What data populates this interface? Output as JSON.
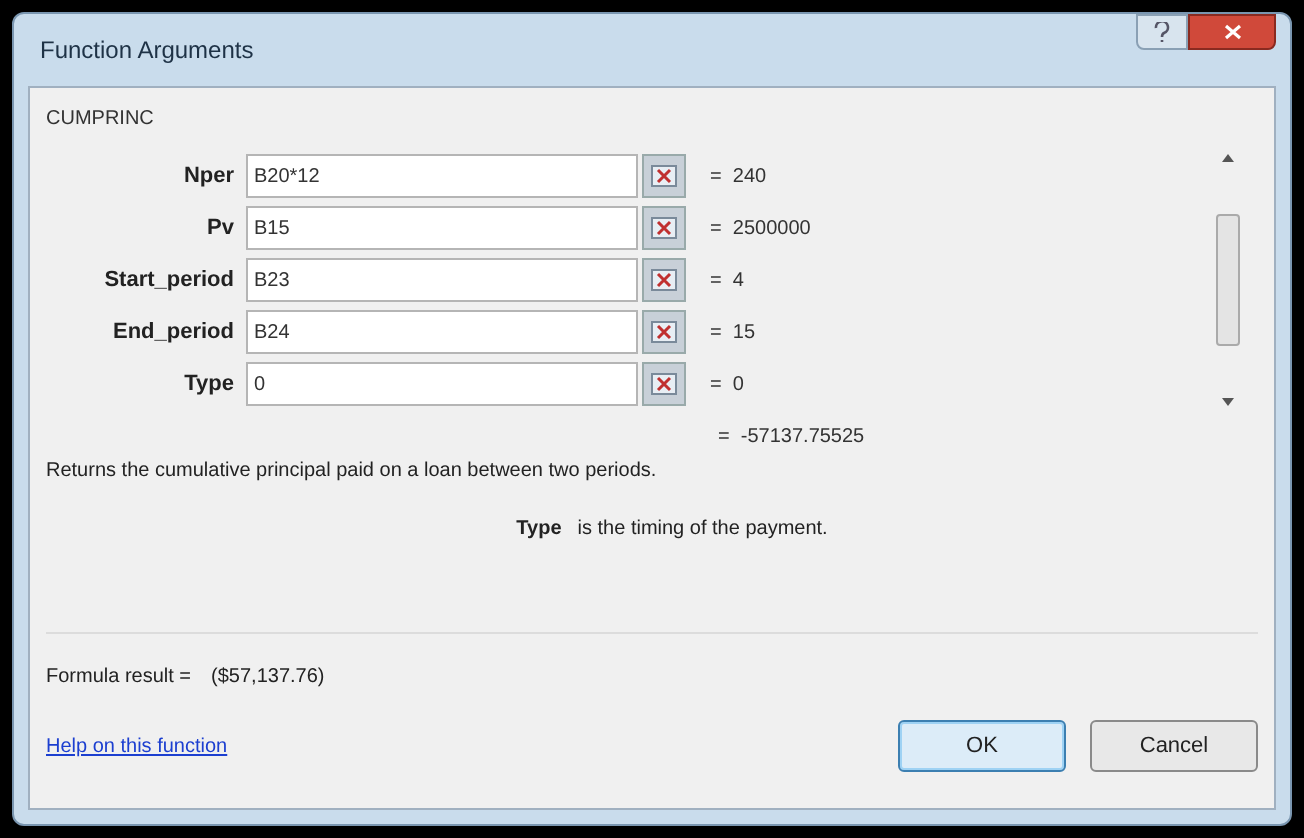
{
  "window": {
    "title": "Function Arguments"
  },
  "function_name": "CUMPRINC",
  "arguments": [
    {
      "label": "Nper",
      "value": "B20*12",
      "result": "=  240"
    },
    {
      "label": "Pv",
      "value": "B15",
      "result": "=  2500000"
    },
    {
      "label": "Start_period",
      "value": "B23",
      "result": "=  4"
    },
    {
      "label": "End_period",
      "value": "B24",
      "result": "=  15"
    },
    {
      "label": "Type",
      "value": "0",
      "result": "=  0"
    }
  ],
  "overall_result": "=  -57137.75525",
  "description": "Returns the cumulative principal paid on a loan between two periods.",
  "argument_help": {
    "name": "Type",
    "text": "is the timing of the payment."
  },
  "formula_result": {
    "label": "Formula result =",
    "value": "($57,137.76)"
  },
  "help_link": "Help on this function",
  "buttons": [
    {
      "label": "OK",
      "default": true
    },
    {
      "label": "Cancel",
      "default": false
    }
  ]
}
